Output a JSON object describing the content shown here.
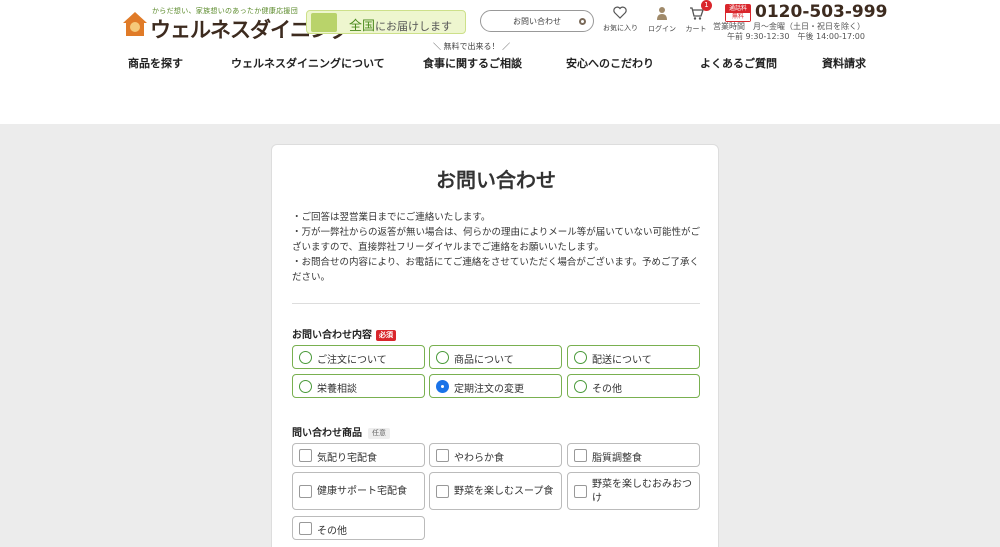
{
  "header": {
    "logo": {
      "tagline": "からだ想い、家族想いのあったか健康応援団",
      "name": "ウェルネスダイニング"
    },
    "delivery": {
      "strong": "全国",
      "rest": "にお届けします"
    },
    "search": {
      "label": "お問い合わせ"
    },
    "icons": {
      "favorites": "お気に入り",
      "login": "ログイン",
      "cart": "カート",
      "cart_count": "1"
    },
    "contact": {
      "freecall_top": "通話料",
      "freecall_bottom": "無料",
      "phone": "0120-503-999",
      "hours_line1": "営業時間　月〜金曜（土日・祝日を除く）",
      "hours_line2": "午前 9:30-12:30　午後 14:00-17:00"
    },
    "nav_note": "＼ 無料で出来る！ ／",
    "nav": [
      "商品を探す",
      "ウェルネスダイニングについて",
      "食事に関するご相談",
      "安心へのこだわり",
      "よくあるご質問",
      "資料請求"
    ]
  },
  "form": {
    "title": "お問い合わせ",
    "notes": [
      "・ご回答は翌営業日までにご連絡いたします。",
      "・万が一弊社からの返答が無い場合は、何らかの理由によりメール等が届いていない可能性がございますので、直接弊社フリーダイヤルまでご連絡をお願いいたします。",
      "・お問合せの内容により、お電話にてご連絡をさせていただく場合がございます。予めご了承ください。"
    ],
    "inquiry_type": {
      "label": "お問い合わせ内容",
      "required_badge": "必須",
      "options": [
        "ご注文について",
        "商品について",
        "配送について",
        "栄養相談",
        "定期注文の変更",
        "その他"
      ],
      "selected": "定期注文の変更"
    },
    "product": {
      "label": "問い合わせ商品",
      "optional_badge": "任意",
      "options": [
        "気配り宅配食",
        "やわらか食",
        "脂質調整食",
        "健康サポート宅配食",
        "野菜を楽しむスープ食",
        "野菜を楽しむおみおつけ",
        "その他"
      ]
    }
  },
  "colors": {
    "accent_green": "#79b050",
    "required_red": "#d9262c",
    "selected_blue": "#1a73e8"
  }
}
